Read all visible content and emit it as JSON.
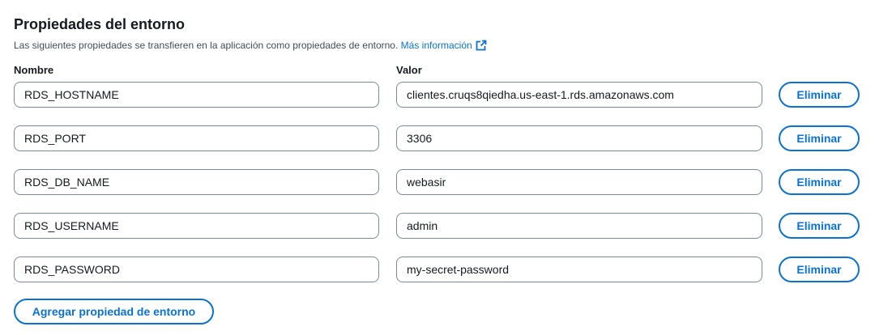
{
  "header": {
    "title": "Propiedades del entorno",
    "description": "Las siguientes propiedades se transfieren en la aplicación como propiedades de entorno.",
    "learn_more_label": "Más información",
    "learn_more_icon": "external-link-icon"
  },
  "columns": {
    "name_label": "Nombre",
    "value_label": "Valor"
  },
  "properties": [
    {
      "name": "RDS_HOSTNAME",
      "value": "clientes.cruqs8qiedha.us-east-1.rds.amazonaws.com",
      "remove_label": "Eliminar"
    },
    {
      "name": "RDS_PORT",
      "value": "3306",
      "remove_label": "Eliminar"
    },
    {
      "name": "RDS_DB_NAME",
      "value": "webasir",
      "remove_label": "Eliminar"
    },
    {
      "name": "RDS_USERNAME",
      "value": "admin",
      "remove_label": "Eliminar"
    },
    {
      "name": "RDS_PASSWORD",
      "value": "my-secret-password",
      "remove_label": "Eliminar"
    }
  ],
  "footer": {
    "add_label": "Agregar propiedad de entorno"
  },
  "colors": {
    "accent": "#0972d3",
    "border": "#7d8998",
    "text": "#16191f"
  }
}
